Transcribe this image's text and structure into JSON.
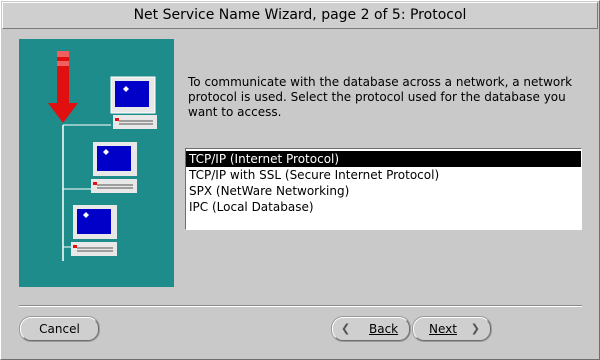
{
  "window": {
    "title": "Net Service Name Wizard, page 2 of 5: Protocol"
  },
  "illustration": {
    "icon": "network-computers-illustration",
    "background": "#1f8c8c",
    "arrow_color": "#e01010"
  },
  "intro_text": "To communicate with the database across a network, a network protocol is used.  Select the protocol used for the database you want to access.",
  "protocols": {
    "selected_index": 0,
    "items": [
      {
        "label": "TCP/IP (Internet Protocol)"
      },
      {
        "label": "TCP/IP with SSL (Secure Internet Protocol)"
      },
      {
        "label": "SPX (NetWare Networking)"
      },
      {
        "label": "IPC (Local Database)"
      }
    ]
  },
  "buttons": {
    "cancel": "Cancel",
    "back": "Back",
    "next": "Next"
  }
}
